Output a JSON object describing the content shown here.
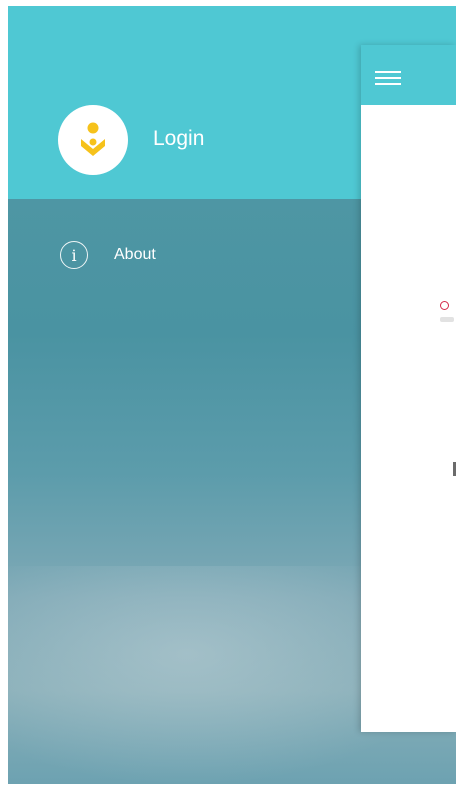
{
  "drawer": {
    "login_label": "Login",
    "about_label": "About",
    "info_glyph": "i",
    "icons": [
      "user-logo-icon",
      "info-icon"
    ]
  },
  "panel": {
    "menu_icon": "hamburger-icon"
  },
  "colors": {
    "header": "#4fc8d3",
    "logo_yellow": "#f6c21b",
    "dot_red": "#d42a4a"
  }
}
